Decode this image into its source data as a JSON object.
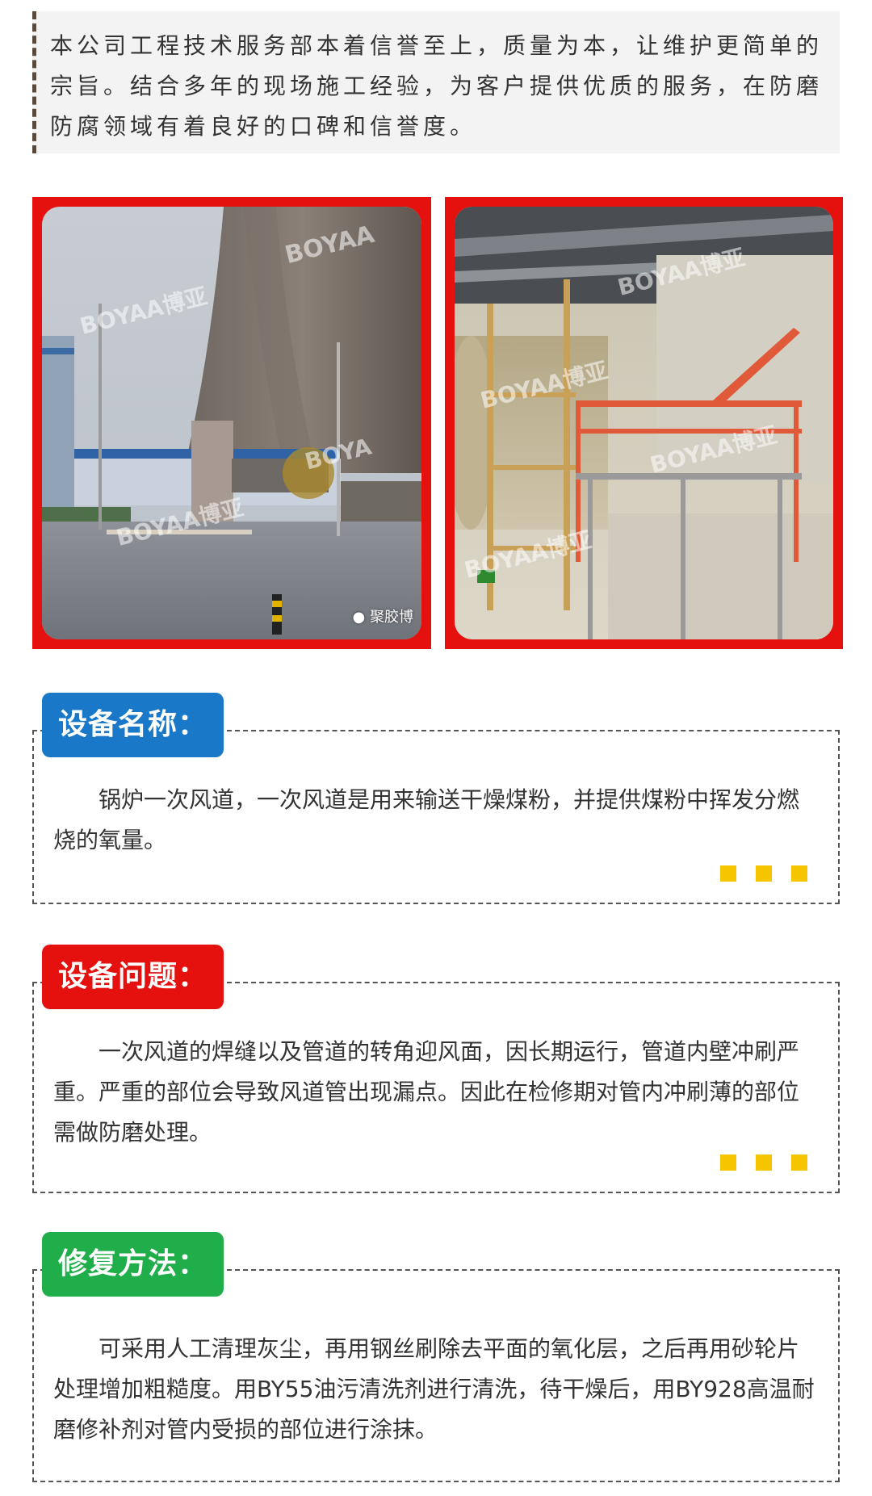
{
  "intro": {
    "text": "本公司工程技术服务部本着信誉至上，质量为本，让维护更简单的宗旨。结合多年的现场施工经验，为客户提供优质的服务，在防磨防腐领域有着良好的口碑和信誉度。"
  },
  "photos": [
    {
      "watermarks": [
        "BOYAA",
        "BOYAA博亚",
        "BOYA",
        "BOYAA博亚"
      ],
      "caption": "聚胶博"
    },
    {
      "watermarks": [
        "BOYAA博亚",
        "BOYAA博亚",
        "BOYAA博亚",
        "BOYAA博亚"
      ]
    }
  ],
  "sections": [
    {
      "title": "设备名称：",
      "color": "#1a78c9",
      "text": "锅炉一次风道，一次风道是用来输送干燥煤粉，并提供煤粉中挥发分燃烧的氧量。"
    },
    {
      "title": "设备问题：",
      "color": "#e5110f",
      "text": "一次风道的焊缝以及管道的转角迎风面，因长期运行，管道内壁冲刷严重。严重的部位会导致风道管出现漏点。因此在检修期对管内冲刷薄的部位需做防磨处理。"
    },
    {
      "title": "修复方法：",
      "color": "#1fae4a",
      "text": "可采用人工清理灰尘，再用钢丝刷除去平面的氧化层，之后再用砂轮片处理增加粗糙度。用BY55油污清洗剂进行清洗，待干燥后，用BY928高温耐磨修补剂对管内受损的部位进行涂抹。"
    }
  ],
  "accent_color": "#f5c500"
}
